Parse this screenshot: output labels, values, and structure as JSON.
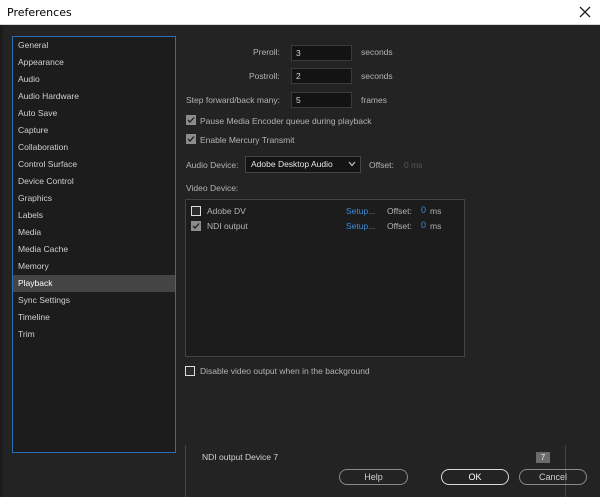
{
  "window": {
    "title": "Preferences"
  },
  "sidebar": {
    "items": [
      {
        "label": "General"
      },
      {
        "label": "Appearance"
      },
      {
        "label": "Audio"
      },
      {
        "label": "Audio Hardware"
      },
      {
        "label": "Auto Save"
      },
      {
        "label": "Capture"
      },
      {
        "label": "Collaboration"
      },
      {
        "label": "Control Surface"
      },
      {
        "label": "Device Control"
      },
      {
        "label": "Graphics"
      },
      {
        "label": "Labels"
      },
      {
        "label": "Media"
      },
      {
        "label": "Media Cache"
      },
      {
        "label": "Memory"
      },
      {
        "label": "Playback"
      },
      {
        "label": "Sync Settings"
      },
      {
        "label": "Timeline"
      },
      {
        "label": "Trim"
      }
    ],
    "selected": "Playback"
  },
  "playback": {
    "preroll": {
      "label": "Preroll:",
      "value": "3",
      "unit": "seconds"
    },
    "postroll": {
      "label": "Postroll:",
      "value": "2",
      "unit": "seconds"
    },
    "step": {
      "label": "Step forward/back many:",
      "value": "5",
      "unit": "frames"
    },
    "pause_encoder": {
      "label": "Pause Media Encoder queue during playback",
      "checked": true
    },
    "mercury": {
      "label": "Enable Mercury Transmit",
      "checked": true
    },
    "audio_device": {
      "label": "Audio Device:",
      "value": "Adobe Desktop Audio",
      "offset_label": "Offset:",
      "offset_value": "0 ms"
    },
    "video_device": {
      "label": "Video Device:",
      "devices": [
        {
          "name": "Adobe DV",
          "checked": false,
          "setup": "Setup...",
          "offset_label": "Offset:",
          "offset_value": "0",
          "offset_unit": "ms"
        },
        {
          "name": "NDI output",
          "checked": true,
          "setup": "Setup...",
          "offset_label": "Offset:",
          "offset_value": "0",
          "offset_unit": "ms"
        }
      ]
    },
    "disable_bg": {
      "label": "Disable video output when in the background",
      "checked": false
    }
  },
  "bottom": {
    "device_label": "NDI output Device 7",
    "device_number": "7"
  },
  "buttons": {
    "help": "Help",
    "ok": "OK",
    "cancel": "Cancel"
  },
  "colors": {
    "accent": "#3d8ddd",
    "focus_border": "#2a6fb6",
    "selected_bg": "#444444"
  }
}
